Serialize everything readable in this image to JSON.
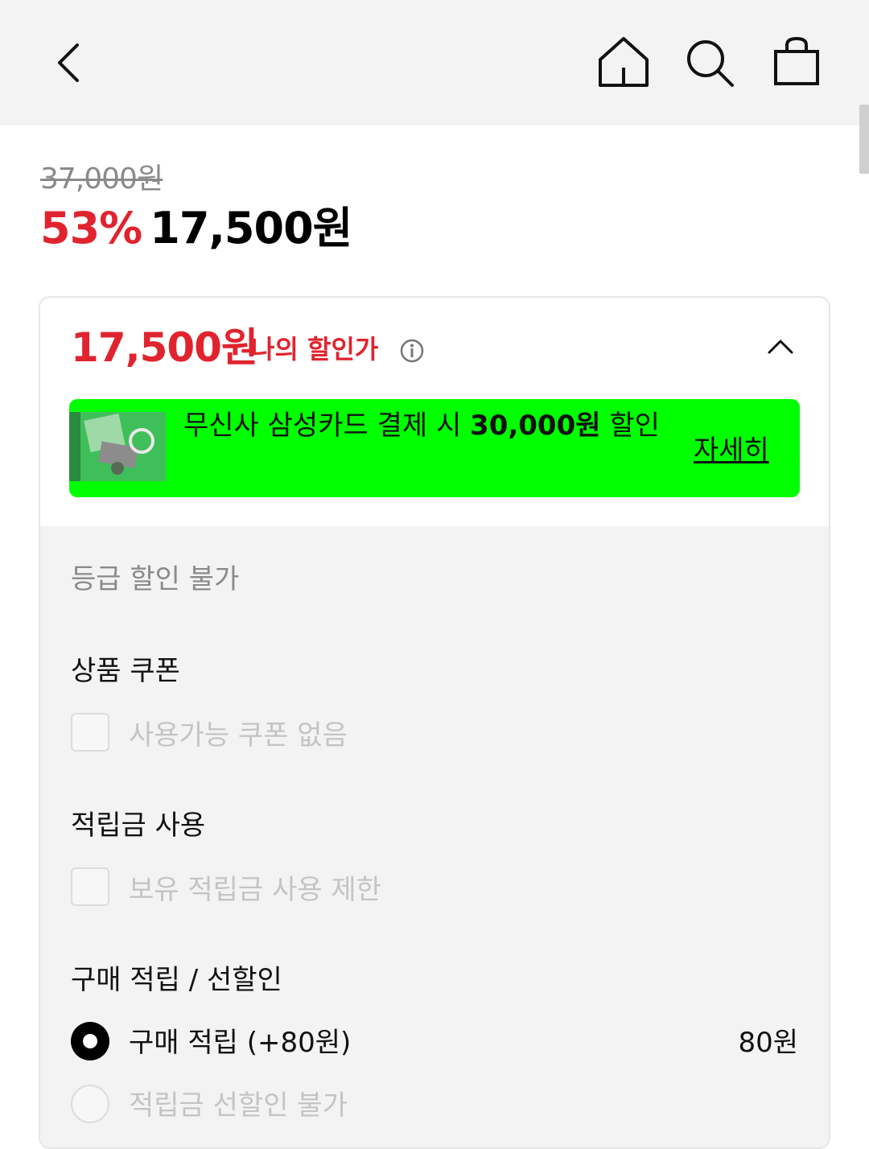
{
  "header": {
    "back": "back-icon",
    "home": "home-icon",
    "search": "search-icon",
    "cart": "shopping-bag-icon"
  },
  "price": {
    "original": "37,000원",
    "discount_rate": "53%",
    "sale": "17,500원"
  },
  "my_price": {
    "amount": "17,500원",
    "label": "나의 할인가"
  },
  "banner": {
    "text_prefix": "무신사 삼성카드 결제 시 ",
    "text_bold": "30,000원",
    "text_suffix": " 할인",
    "link": "자세히",
    "background": "#00ff00"
  },
  "discounts": {
    "grade_note": "등급 할인 불가",
    "coupon": {
      "title": "상품 쿠폰",
      "option": "사용가능 쿠폰 없음"
    },
    "points": {
      "title": "적립금 사용",
      "option": "보유 적립금 사용 제한"
    },
    "purchase": {
      "title": "구매 적립 / 선할인",
      "earn_label": "구매 적립 (+80원)",
      "earn_amount": "80원",
      "pre_discount_label": "적립금 선할인 불가"
    }
  },
  "colors": {
    "accent_red": "#e0242f",
    "banner_green": "#00ff00"
  }
}
